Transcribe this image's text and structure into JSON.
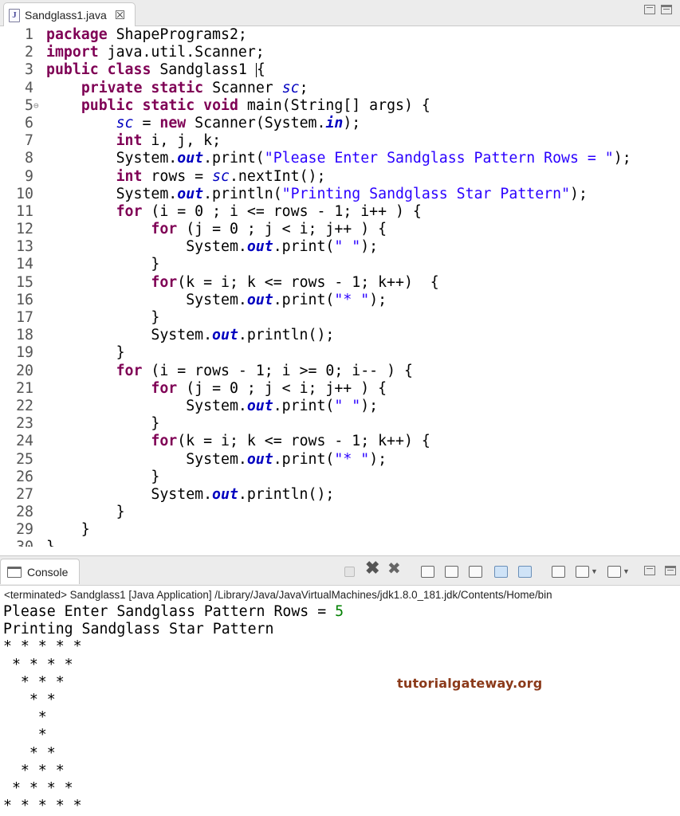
{
  "editor": {
    "tab_title": "Sandglass1.java",
    "tab_close": "☒",
    "file_icon_glyph": "J",
    "code": [
      {
        "n": "1",
        "parts": [
          {
            "t": "package",
            "c": "kw"
          },
          {
            "t": " ShapePrograms2;"
          }
        ]
      },
      {
        "n": "2",
        "parts": [
          {
            "t": "import",
            "c": "kw"
          },
          {
            "t": " java.util.Scanner;"
          }
        ]
      },
      {
        "n": "3",
        "parts": [
          {
            "t": "public",
            "c": "kw"
          },
          {
            "t": " "
          },
          {
            "t": "class",
            "c": "kw"
          },
          {
            "t": " Sandglass1 "
          },
          {
            "t": "",
            "c": "caret"
          },
          {
            "t": "{"
          }
        ]
      },
      {
        "n": "4",
        "parts": [
          {
            "t": "    "
          },
          {
            "t": "private",
            "c": "kw"
          },
          {
            "t": " "
          },
          {
            "t": "static",
            "c": "kw"
          },
          {
            "t": " Scanner "
          },
          {
            "t": "sc",
            "c": "fld"
          },
          {
            "t": ";"
          }
        ]
      },
      {
        "n": "5",
        "fold": "⊖",
        "parts": [
          {
            "t": "    "
          },
          {
            "t": "public",
            "c": "kw"
          },
          {
            "t": " "
          },
          {
            "t": "static",
            "c": "kw"
          },
          {
            "t": " "
          },
          {
            "t": "void",
            "c": "kw"
          },
          {
            "t": " main(String[] args) {"
          }
        ]
      },
      {
        "n": "6",
        "parts": [
          {
            "t": "        "
          },
          {
            "t": "sc",
            "c": "fld"
          },
          {
            "t": " = "
          },
          {
            "t": "new",
            "c": "kw"
          },
          {
            "t": " Scanner(System."
          },
          {
            "t": "in",
            "c": "sfld"
          },
          {
            "t": ");"
          }
        ]
      },
      {
        "n": "7",
        "parts": [
          {
            "t": "        "
          },
          {
            "t": "int",
            "c": "kw"
          },
          {
            "t": " i, j, k;"
          }
        ]
      },
      {
        "n": "8",
        "parts": [
          {
            "t": "        System."
          },
          {
            "t": "out",
            "c": "sfld"
          },
          {
            "t": ".print("
          },
          {
            "t": "\"Please Enter Sandglass Pattern Rows = \"",
            "c": "str"
          },
          {
            "t": ");"
          }
        ]
      },
      {
        "n": "9",
        "parts": [
          {
            "t": "        "
          },
          {
            "t": "int",
            "c": "kw"
          },
          {
            "t": " rows = "
          },
          {
            "t": "sc",
            "c": "fld"
          },
          {
            "t": ".nextInt();"
          }
        ]
      },
      {
        "n": "10",
        "parts": [
          {
            "t": "        System."
          },
          {
            "t": "out",
            "c": "sfld"
          },
          {
            "t": ".println("
          },
          {
            "t": "\"Printing Sandglass Star Pattern\"",
            "c": "str"
          },
          {
            "t": ");"
          }
        ]
      },
      {
        "n": "11",
        "parts": [
          {
            "t": "        "
          },
          {
            "t": "for",
            "c": "kw"
          },
          {
            "t": " (i = 0 ; i <= rows - 1; i++ ) {"
          }
        ]
      },
      {
        "n": "12",
        "parts": [
          {
            "t": "            "
          },
          {
            "t": "for",
            "c": "kw"
          },
          {
            "t": " (j = 0 ; j < i; j++ ) {"
          }
        ]
      },
      {
        "n": "13",
        "parts": [
          {
            "t": "                System."
          },
          {
            "t": "out",
            "c": "sfld"
          },
          {
            "t": ".print("
          },
          {
            "t": "\" \"",
            "c": "str"
          },
          {
            "t": ");"
          }
        ]
      },
      {
        "n": "14",
        "parts": [
          {
            "t": "            }"
          }
        ]
      },
      {
        "n": "15",
        "parts": [
          {
            "t": "            "
          },
          {
            "t": "for",
            "c": "kw"
          },
          {
            "t": "(k = i; k <= rows - 1; k++)  {"
          }
        ]
      },
      {
        "n": "16",
        "parts": [
          {
            "t": "                System."
          },
          {
            "t": "out",
            "c": "sfld"
          },
          {
            "t": ".print("
          },
          {
            "t": "\"* \"",
            "c": "str"
          },
          {
            "t": ");"
          }
        ]
      },
      {
        "n": "17",
        "parts": [
          {
            "t": "            }"
          }
        ]
      },
      {
        "n": "18",
        "parts": [
          {
            "t": "            System."
          },
          {
            "t": "out",
            "c": "sfld"
          },
          {
            "t": ".println();"
          }
        ]
      },
      {
        "n": "19",
        "parts": [
          {
            "t": "        }"
          }
        ]
      },
      {
        "n": "20",
        "parts": [
          {
            "t": "        "
          },
          {
            "t": "for",
            "c": "kw"
          },
          {
            "t": " (i = rows - 1; i >= 0; i-- ) {"
          }
        ]
      },
      {
        "n": "21",
        "parts": [
          {
            "t": "            "
          },
          {
            "t": "for",
            "c": "kw"
          },
          {
            "t": " (j = 0 ; j < i; j++ ) {"
          }
        ]
      },
      {
        "n": "22",
        "parts": [
          {
            "t": "                System."
          },
          {
            "t": "out",
            "c": "sfld"
          },
          {
            "t": ".print("
          },
          {
            "t": "\" \"",
            "c": "str"
          },
          {
            "t": ");"
          }
        ]
      },
      {
        "n": "23",
        "parts": [
          {
            "t": "            }"
          }
        ]
      },
      {
        "n": "24",
        "parts": [
          {
            "t": "            "
          },
          {
            "t": "for",
            "c": "kw"
          },
          {
            "t": "(k = i; k <= rows - 1; k++) {"
          }
        ]
      },
      {
        "n": "25",
        "parts": [
          {
            "t": "                System."
          },
          {
            "t": "out",
            "c": "sfld"
          },
          {
            "t": ".print("
          },
          {
            "t": "\"* \"",
            "c": "str"
          },
          {
            "t": ");"
          }
        ]
      },
      {
        "n": "26",
        "parts": [
          {
            "t": "            }"
          }
        ]
      },
      {
        "n": "27",
        "parts": [
          {
            "t": "            System."
          },
          {
            "t": "out",
            "c": "sfld"
          },
          {
            "t": ".println();"
          }
        ]
      },
      {
        "n": "28",
        "parts": [
          {
            "t": "        }"
          }
        ]
      },
      {
        "n": "29",
        "parts": [
          {
            "t": "    }"
          }
        ]
      },
      {
        "n": "30",
        "parts": [
          {
            "t": "}"
          }
        ]
      }
    ]
  },
  "console": {
    "tab_label": "Console",
    "status": "<terminated> Sandglass1 [Java Application] /Library/Java/JavaVirtualMachines/jdk1.8.0_181.jdk/Contents/Home/bin",
    "prompt": "Please Enter Sandglass Pattern Rows = ",
    "input": "5",
    "output": [
      "Printing Sandglass Star Pattern",
      "* * * * * ",
      " * * * * ",
      "  * * * ",
      "   * * ",
      "    * ",
      "    * ",
      "   * * ",
      "  * * * ",
      " * * * * ",
      "* * * * * "
    ],
    "toolbar_icons": [
      "terminate-icon",
      "remove-launch-icon",
      "remove-all-icon",
      "clear-console-icon",
      "scroll-lock-icon",
      "word-wrap-icon",
      "show-on-stdout-icon",
      "show-on-stderr-icon",
      "pin-console-icon",
      "display-console-icon",
      "open-console-icon",
      "minimize-icon",
      "maximize-icon"
    ]
  },
  "watermark": "tutorialgateway.org"
}
